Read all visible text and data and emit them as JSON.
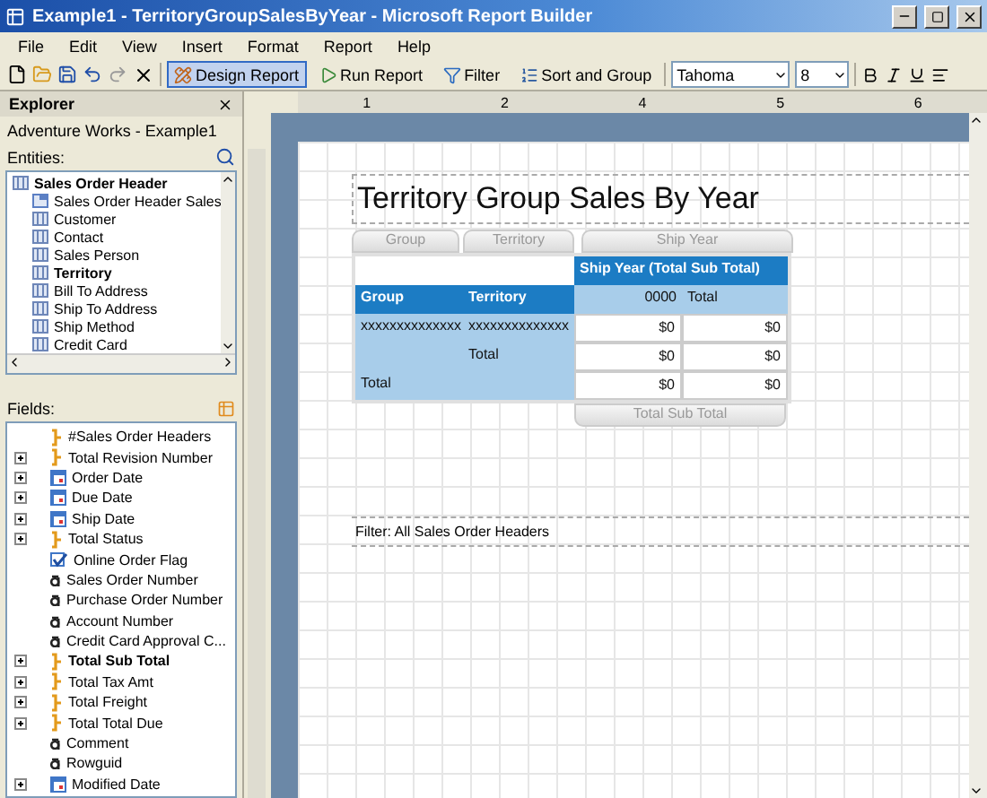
{
  "window": {
    "title": "Example1 - TerritoryGroupSalesByYear - Microsoft Report Builder"
  },
  "menu": [
    "File",
    "Edit",
    "View",
    "Insert",
    "Format",
    "Report",
    "Help"
  ],
  "toolbar": {
    "buttons": [
      {
        "label": "Design Report",
        "selected": true,
        "kind": "design"
      },
      {
        "label": "Run Report",
        "selected": false,
        "kind": "run"
      },
      {
        "label": "Filter",
        "selected": false,
        "kind": "filter"
      },
      {
        "label": "Sort and Group",
        "selected": false,
        "kind": "sort"
      }
    ],
    "font": "Tahoma",
    "size": "8"
  },
  "explorer": {
    "title": "Explorer",
    "model": "Adventure Works - Example1",
    "entities_label": "Entities:",
    "entities": [
      {
        "label": "Sales Order Header",
        "bold": true,
        "kind": "root"
      },
      {
        "label": "Sales Order Header Sales",
        "bold": false,
        "kind": "derived"
      },
      {
        "label": "Customer",
        "bold": false,
        "kind": "table"
      },
      {
        "label": "Contact",
        "bold": false,
        "kind": "table"
      },
      {
        "label": "Sales Person",
        "bold": false,
        "kind": "table"
      },
      {
        "label": "Territory",
        "bold": true,
        "kind": "table"
      },
      {
        "label": "Bill To Address",
        "bold": false,
        "kind": "table"
      },
      {
        "label": "Ship To Address",
        "bold": false,
        "kind": "table"
      },
      {
        "label": "Ship Method",
        "bold": false,
        "kind": "table"
      },
      {
        "label": "Credit Card",
        "bold": false,
        "kind": "table"
      }
    ],
    "fields_label": "Fields:",
    "fields": [
      {
        "label": "#Sales Order Headers",
        "kind": "measure",
        "expandable": false,
        "bold": false
      },
      {
        "label": "Total Revision Number",
        "kind": "measure",
        "expandable": true,
        "bold": false
      },
      {
        "label": "Order Date",
        "kind": "date",
        "expandable": true,
        "bold": false
      },
      {
        "label": "Due Date",
        "kind": "date",
        "expandable": true,
        "bold": false
      },
      {
        "label": "Ship Date",
        "kind": "date",
        "expandable": true,
        "bold": false
      },
      {
        "label": "Total Status",
        "kind": "measure",
        "expandable": true,
        "bold": false
      },
      {
        "label": "Online Order Flag",
        "kind": "flag",
        "expandable": false,
        "bold": false
      },
      {
        "label": "Sales Order Number",
        "kind": "text",
        "expandable": false,
        "bold": false
      },
      {
        "label": "Purchase Order Number",
        "kind": "text",
        "expandable": false,
        "bold": false
      },
      {
        "label": "Account Number",
        "kind": "text",
        "expandable": false,
        "bold": false
      },
      {
        "label": "Credit Card Approval C...",
        "kind": "text",
        "expandable": false,
        "bold": false
      },
      {
        "label": "Total Sub Total",
        "kind": "measure",
        "expandable": true,
        "bold": true
      },
      {
        "label": "Total Tax Amt",
        "kind": "measure",
        "expandable": true,
        "bold": false
      },
      {
        "label": "Total Freight",
        "kind": "measure",
        "expandable": true,
        "bold": false
      },
      {
        "label": "Total Total Due",
        "kind": "measure",
        "expandable": true,
        "bold": false
      },
      {
        "label": "Comment",
        "kind": "text",
        "expandable": false,
        "bold": false
      },
      {
        "label": "Rowguid",
        "kind": "text",
        "expandable": false,
        "bold": false
      },
      {
        "label": "Modified Date",
        "kind": "date",
        "expandable": true,
        "bold": false
      }
    ]
  },
  "ruler": [
    "1",
    "2",
    "4",
    "5",
    "6"
  ],
  "report": {
    "title": "Territory Group Sales By Year",
    "row_group_tabs": [
      "Group",
      "Territory"
    ],
    "column_group_tab": "Ship Year",
    "matrix_title": "Ship Year (Total Sub Total)",
    "header": [
      "Group",
      "Territory",
      "0000",
      "Total"
    ],
    "rows": [
      {
        "group": "xxxxxxxxxxxxxx",
        "territory": "xxxxxxxxxxxxxx",
        "values": [
          "$0",
          "$0"
        ]
      },
      {
        "territory": "Total",
        "values": [
          "$0",
          "$0"
        ]
      },
      {
        "group": "Total",
        "values": [
          "$0",
          "$0"
        ]
      }
    ],
    "total_tab": "Total Sub Total",
    "filter": "Filter: All Sales Order Headers"
  }
}
